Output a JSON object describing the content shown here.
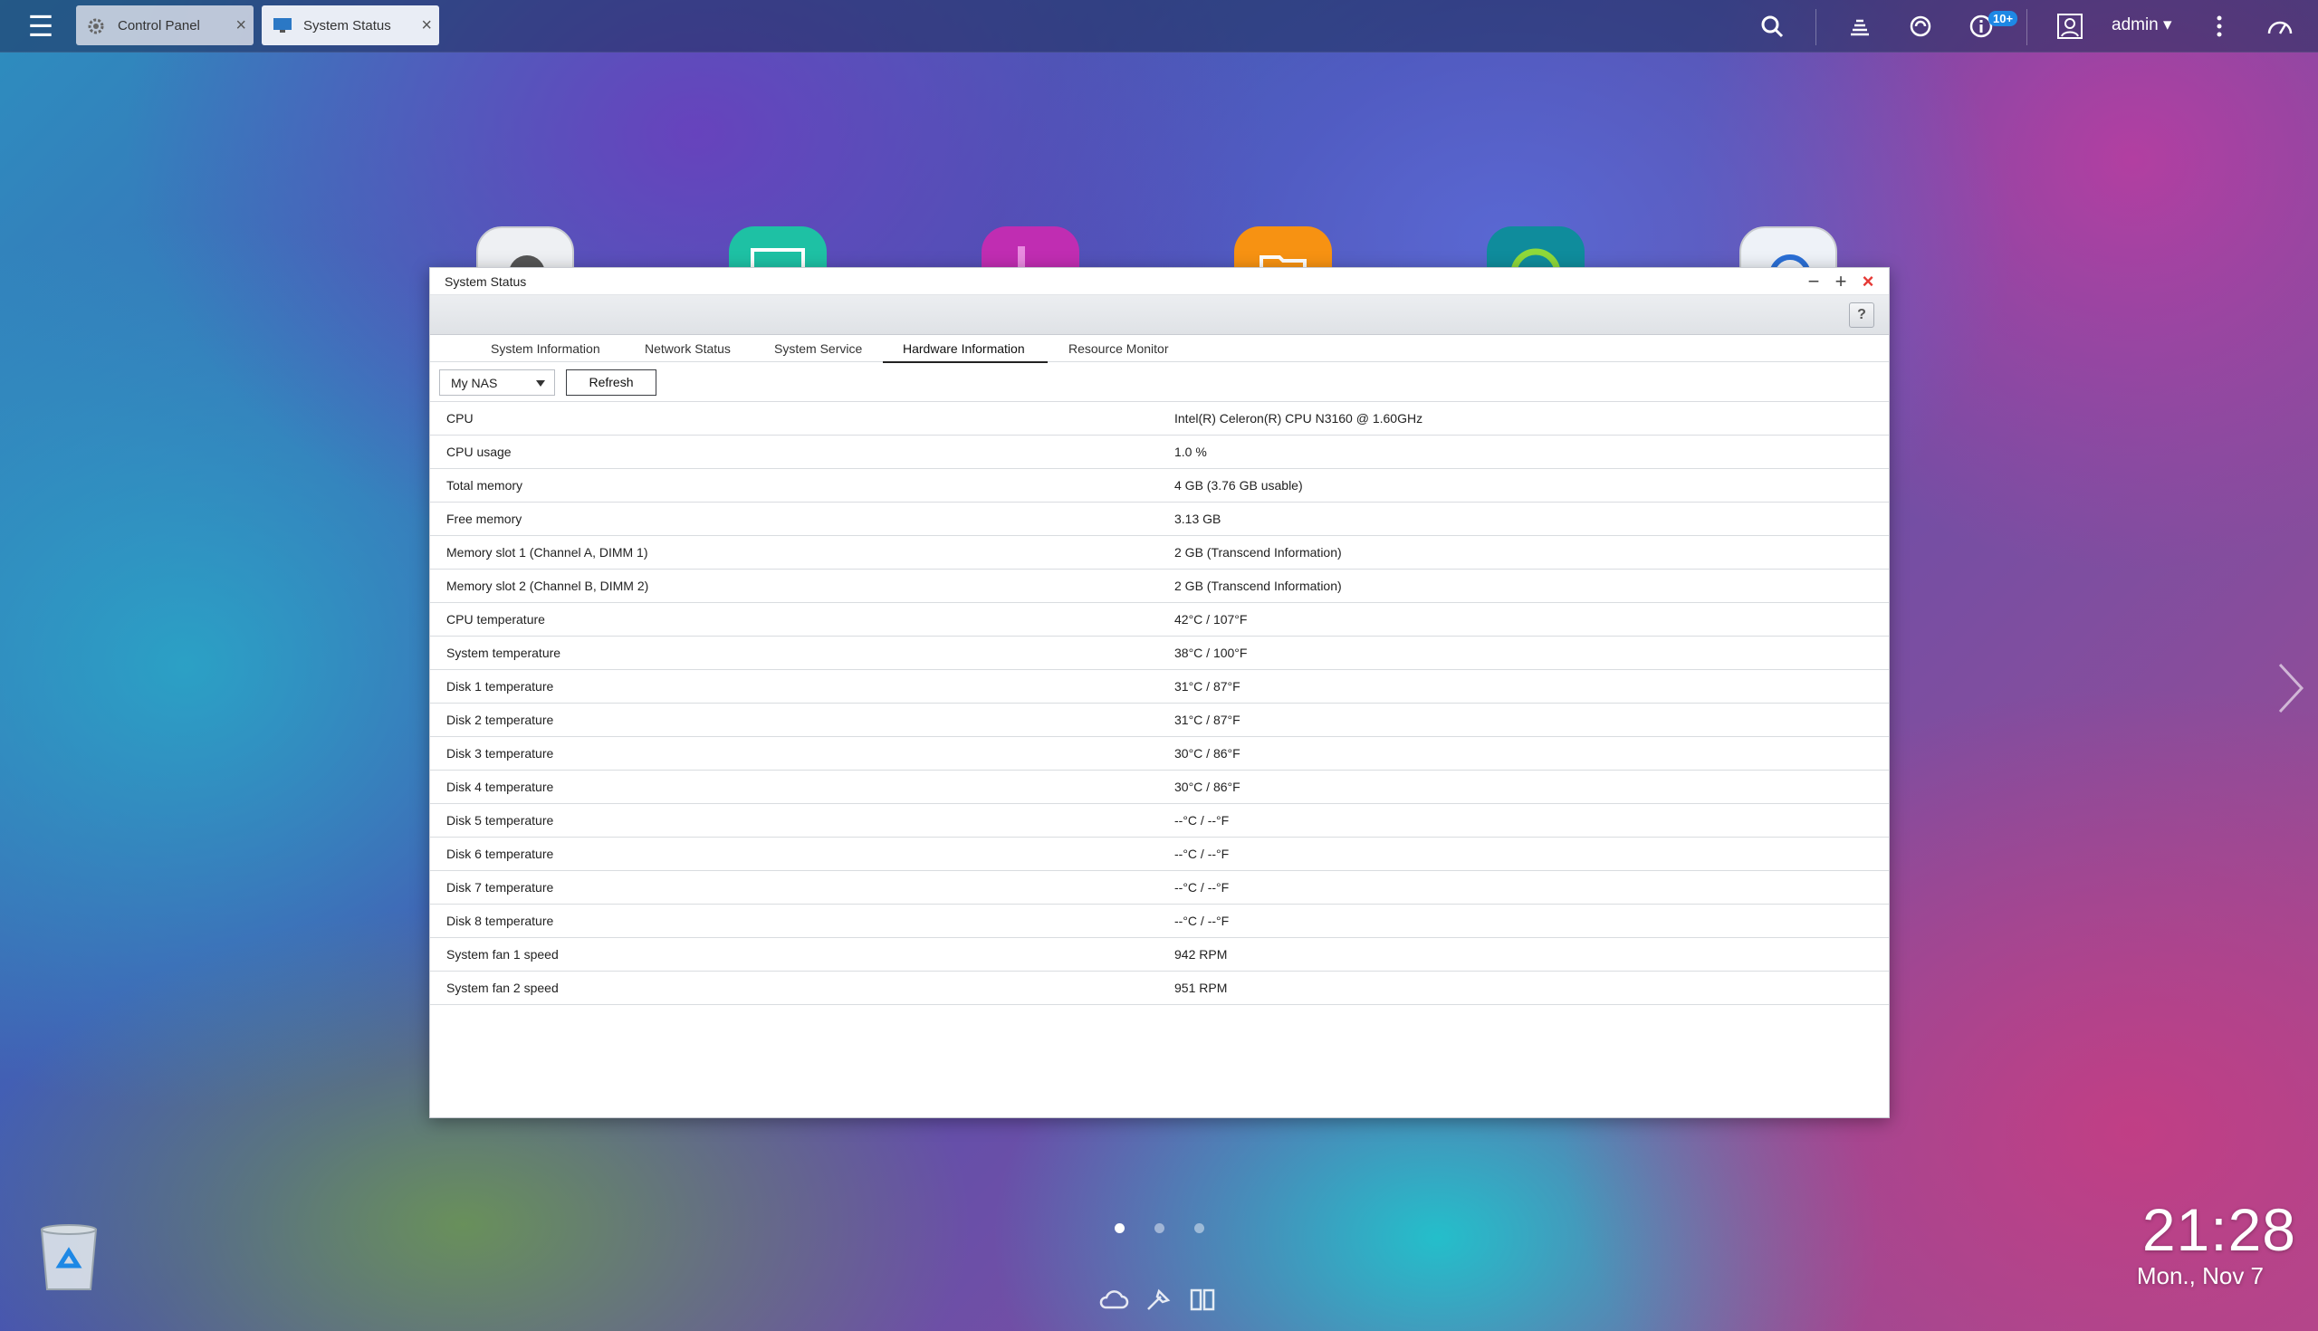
{
  "taskbar": {
    "tabs": [
      {
        "label": "Control Panel",
        "icon": "gear-icon",
        "active": false
      },
      {
        "label": "System Status",
        "icon": "monitor-icon",
        "active": true
      }
    ],
    "notification_badge": "10+",
    "user": "admin"
  },
  "window": {
    "title": "System Status",
    "help_label": "?",
    "tabs": [
      {
        "label": "System Information"
      },
      {
        "label": "Network Status"
      },
      {
        "label": "System Service"
      },
      {
        "label": "Hardware Information",
        "selected": true
      },
      {
        "label": "Resource Monitor"
      }
    ],
    "nas_select_value": "My NAS",
    "refresh_label": "Refresh",
    "rows": [
      {
        "label": "CPU",
        "value": "Intel(R) Celeron(R) CPU N3160 @ 1.60GHz"
      },
      {
        "label": "CPU usage",
        "value": "1.0 %"
      },
      {
        "label": "Total memory",
        "value": "4 GB (3.76 GB usable)"
      },
      {
        "label": "Free memory",
        "value": "3.13 GB"
      },
      {
        "label": "Memory slot 1 (Channel A, DIMM 1)",
        "value": "2 GB (Transcend Information)"
      },
      {
        "label": "Memory slot 2 (Channel B, DIMM 2)",
        "value": "2 GB (Transcend Information)"
      },
      {
        "label": "CPU temperature",
        "value": "42°C / 107°F"
      },
      {
        "label": "System temperature",
        "value": "38°C / 100°F"
      },
      {
        "label": "Disk 1 temperature",
        "value": "31°C / 87°F"
      },
      {
        "label": "Disk 2 temperature",
        "value": "31°C / 87°F"
      },
      {
        "label": "Disk 3 temperature",
        "value": "30°C / 86°F"
      },
      {
        "label": "Disk 4 temperature",
        "value": "30°C / 86°F"
      },
      {
        "label": "Disk 5 temperature",
        "value": "--°C / --°F"
      },
      {
        "label": "Disk 6 temperature",
        "value": "--°C / --°F"
      },
      {
        "label": "Disk 7 temperature",
        "value": "--°C / --°F"
      },
      {
        "label": "Disk 8 temperature",
        "value": "--°C / --°F"
      },
      {
        "label": "System fan 1 speed",
        "value": "942 RPM"
      },
      {
        "label": "System fan 2 speed",
        "value": "951 RPM"
      }
    ]
  },
  "desktop": {
    "clock_time": "21:28",
    "clock_date": "Mon., Nov 7",
    "pages": 3,
    "current_page": 1
  },
  "colors": {
    "accent": "#1e88e5",
    "close_red": "#e53935"
  }
}
